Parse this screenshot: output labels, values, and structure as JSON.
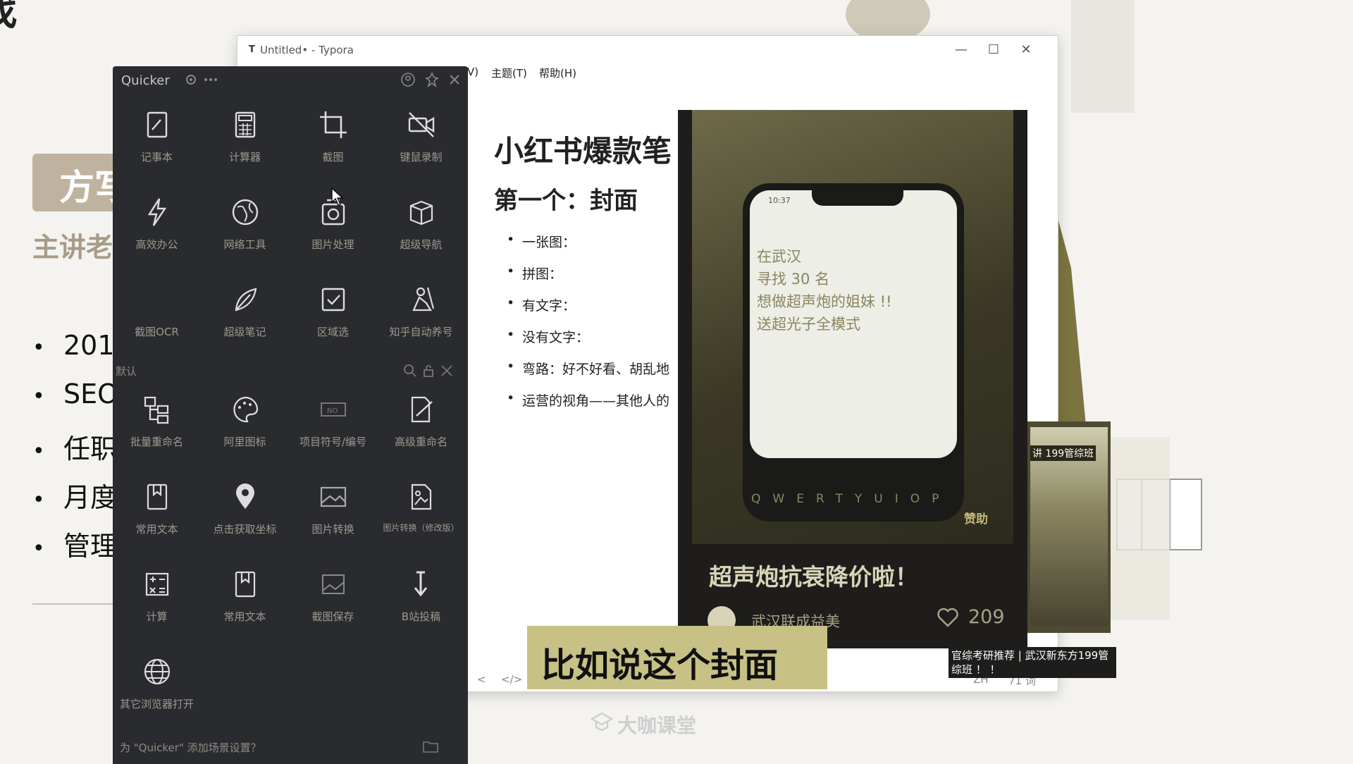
{
  "slide": {
    "title": "找",
    "badge": "方写",
    "subtitle": "主讲老",
    "bullets": [
      "201",
      "SEO",
      "任职",
      "月度",
      "管理"
    ]
  },
  "typora": {
    "window_title": "Untitled• - Typora",
    "menus": [
      "V)",
      "主题(T)",
      "帮助(H)"
    ],
    "heading1": "小红书爆款笔",
    "heading2": "第一个：封面",
    "list_items": [
      "一张图：",
      "拼图：",
      "有文字：",
      "没有文字：",
      "弯路：好不好看、胡乱地",
      "运营的视角——其他人的"
    ],
    "status": {
      "back": "<",
      "source": "</>",
      "lang": "ZH",
      "words": "71 词"
    }
  },
  "quicker": {
    "title": "Quicker",
    "grid_top": [
      {
        "label": "记事本",
        "icon": "notepad-icon"
      },
      {
        "label": "计算器",
        "icon": "calculator-icon"
      },
      {
        "label": "截图",
        "icon": "crop-icon"
      },
      {
        "label": "键鼠录制",
        "icon": "video-off-icon"
      },
      {
        "label": "高效办公",
        "icon": "lightning-icon"
      },
      {
        "label": "网络工具",
        "icon": "globe-icon"
      },
      {
        "label": "图片处理",
        "icon": "image-process-icon"
      },
      {
        "label": "超级导航",
        "icon": "box-icon"
      },
      {
        "label": "截图OCR",
        "icon": "ocr-icon"
      },
      {
        "label": "超级笔记",
        "icon": "feather-icon"
      },
      {
        "label": "区域选",
        "icon": "checkbox-icon"
      },
      {
        "label": "知乎自动养号",
        "icon": "worker-icon"
      }
    ],
    "section_label": "默认",
    "grid_bottom": [
      {
        "label": "批量重命名",
        "icon": "rename-tree-icon"
      },
      {
        "label": "阿里图标",
        "icon": "palette-icon"
      },
      {
        "label": "项目符号/编号",
        "icon": "ticket-no-icon"
      },
      {
        "label": "高级重命名",
        "icon": "edit-doc-icon"
      },
      {
        "label": "常用文本",
        "icon": "bookmark-doc-icon"
      },
      {
        "label": "点击获取坐标",
        "icon": "map-pin-icon"
      },
      {
        "label": "图片转换",
        "icon": "image-icon"
      },
      {
        "label": "图片转换（修改版）",
        "icon": "image-doc-icon"
      },
      {
        "label": "计算",
        "icon": "calc-ops-icon"
      },
      {
        "label": "常用文本",
        "icon": "bookmark-doc-icon"
      },
      {
        "label": "截图保存",
        "icon": "screenshot-save-icon"
      },
      {
        "label": "B站投稿",
        "icon": "upload-down-icon"
      },
      {
        "label": "其它浏览器打开",
        "icon": "browser-globe-icon"
      }
    ],
    "footer": "为 \"Quicker\" 添加场景设置？"
  },
  "phone": {
    "time": "10:37",
    "lines": [
      "在武汉",
      "寻找 30 名",
      "想做超声炮的姐妹 !!",
      "送超光子全模式"
    ],
    "highlight": "超声炮",
    "keyboard": "QWERTYUIOP",
    "sponsor": "赞助",
    "caption": "超声炮抗衰降价啦！",
    "author": "武汉联成益美",
    "likes": "209"
  },
  "thumb": {
    "tag": "讲 199管综班",
    "caption": "官综考研推荐 | 武汉新东方199管综班 ！ ！"
  },
  "subtitle": "比如说这个封面",
  "brand": "大咖课堂",
  "colors": {
    "quicker_bg": "#2a2b2f",
    "subtitle_bg": "#c8c185",
    "phone_text": "#8a8560"
  }
}
